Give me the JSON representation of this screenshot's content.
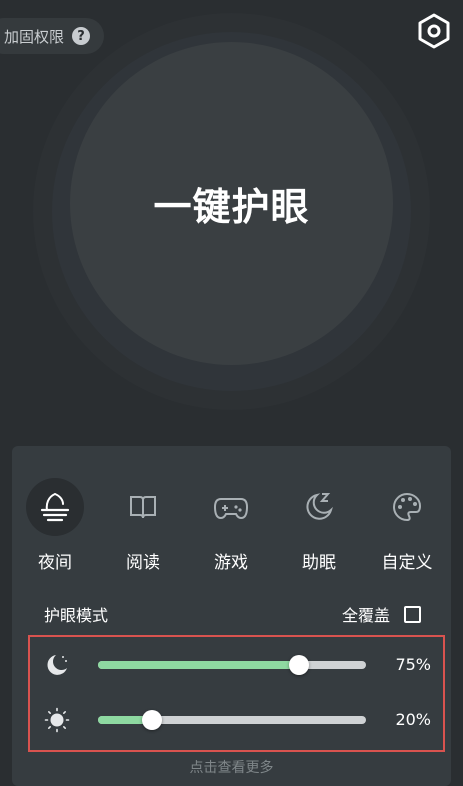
{
  "header": {
    "permission_label": "加固权限",
    "help_icon_text": "?",
    "settings_icon": "hexagon-gear-icon"
  },
  "main_button": {
    "label": "一键护眼"
  },
  "modes": [
    {
      "label": "夜间",
      "icon": "night-lamp-icon",
      "active": true
    },
    {
      "label": "阅读",
      "icon": "book-icon",
      "active": false
    },
    {
      "label": "游戏",
      "icon": "gamepad-icon",
      "active": false
    },
    {
      "label": "助眠",
      "icon": "moon-sleep-icon",
      "active": false
    },
    {
      "label": "自定义",
      "icon": "palette-icon",
      "active": false
    }
  ],
  "eye_mode": {
    "title": "护眼模式",
    "full_cover_label": "全覆盖",
    "full_cover_checked": false
  },
  "sliders": [
    {
      "icon": "moon-icon",
      "value": 0.75,
      "label": "75%"
    },
    {
      "icon": "sun-icon",
      "value": 0.2,
      "label": "20%"
    }
  ],
  "footer": {
    "more_label": "点击查看更多"
  },
  "colors": {
    "background": "#2a2e31",
    "panel": "#363c40",
    "slider_fill": "#8ed9a1",
    "slider_track": "#cfd2d4",
    "highlight_border": "#d9534f"
  }
}
